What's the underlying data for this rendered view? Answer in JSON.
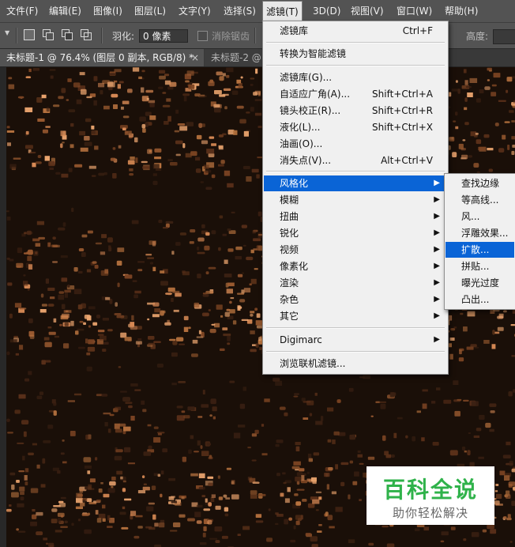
{
  "menubar": {
    "items": [
      {
        "label": "文件(F)"
      },
      {
        "label": "编辑(E)"
      },
      {
        "label": "图像(I)"
      },
      {
        "label": "图层(L)"
      },
      {
        "label": "文字(Y)"
      },
      {
        "label": "选择(S)"
      },
      {
        "label": "滤镜(T)"
      },
      {
        "label": "3D(D)"
      },
      {
        "label": "视图(V)"
      },
      {
        "label": "窗口(W)"
      },
      {
        "label": "帮助(H)"
      }
    ]
  },
  "options": {
    "feather_label": "羽化:",
    "feather_value": "0 像素",
    "antialias_label": "消除锯齿",
    "height_label": "高度:"
  },
  "tabs": [
    {
      "label": "未标题-1 @ 76.4% (图层 0 副本, RGB/8) *",
      "close": "×"
    },
    {
      "label": "未标题-2 @"
    }
  ],
  "filter_menu": {
    "items": {
      "last_filter": {
        "label": "滤镜库",
        "shortcut": "Ctrl+F"
      },
      "smart": {
        "label": "转换为智能滤镜"
      },
      "gallery": {
        "label": "滤镜库(G)..."
      },
      "adaptive_wide": {
        "label": "自适应广角(A)...",
        "shortcut": "Shift+Ctrl+A"
      },
      "lens_correction": {
        "label": "镜头校正(R)...",
        "shortcut": "Shift+Ctrl+R"
      },
      "liquify": {
        "label": "液化(L)...",
        "shortcut": "Shift+Ctrl+X"
      },
      "oil_paint": {
        "label": "油画(O)..."
      },
      "vanishing_point": {
        "label": "消失点(V)...",
        "shortcut": "Alt+Ctrl+V"
      },
      "stylize": {
        "label": "风格化",
        "arrow": "▶"
      },
      "blur": {
        "label": "模糊",
        "arrow": "▶"
      },
      "distort": {
        "label": "扭曲",
        "arrow": "▶"
      },
      "sharpen": {
        "label": "锐化",
        "arrow": "▶"
      },
      "video": {
        "label": "视频",
        "arrow": "▶"
      },
      "pixelate": {
        "label": "像素化",
        "arrow": "▶"
      },
      "render": {
        "label": "渲染",
        "arrow": "▶"
      },
      "noise": {
        "label": "杂色",
        "arrow": "▶"
      },
      "other": {
        "label": "其它",
        "arrow": "▶"
      },
      "digimarc": {
        "label": "Digimarc",
        "arrow": "▶"
      },
      "browse_online": {
        "label": "浏览联机滤镜..."
      }
    }
  },
  "stylize_submenu": {
    "items": [
      {
        "label": "查找边缘"
      },
      {
        "label": "等高线..."
      },
      {
        "label": "风..."
      },
      {
        "label": "浮雕效果..."
      },
      {
        "label": "扩散..."
      },
      {
        "label": "拼贴..."
      },
      {
        "label": "曝光过度"
      },
      {
        "label": "凸出..."
      }
    ]
  },
  "watermark": {
    "title": "百科全说",
    "subtitle": "助你轻松解决"
  },
  "colors": {
    "menu_highlight": "#0a64d6",
    "texture_light": "#d88a55",
    "texture_dark": "#1a0f08",
    "watermark_green": "#2fb24a"
  }
}
